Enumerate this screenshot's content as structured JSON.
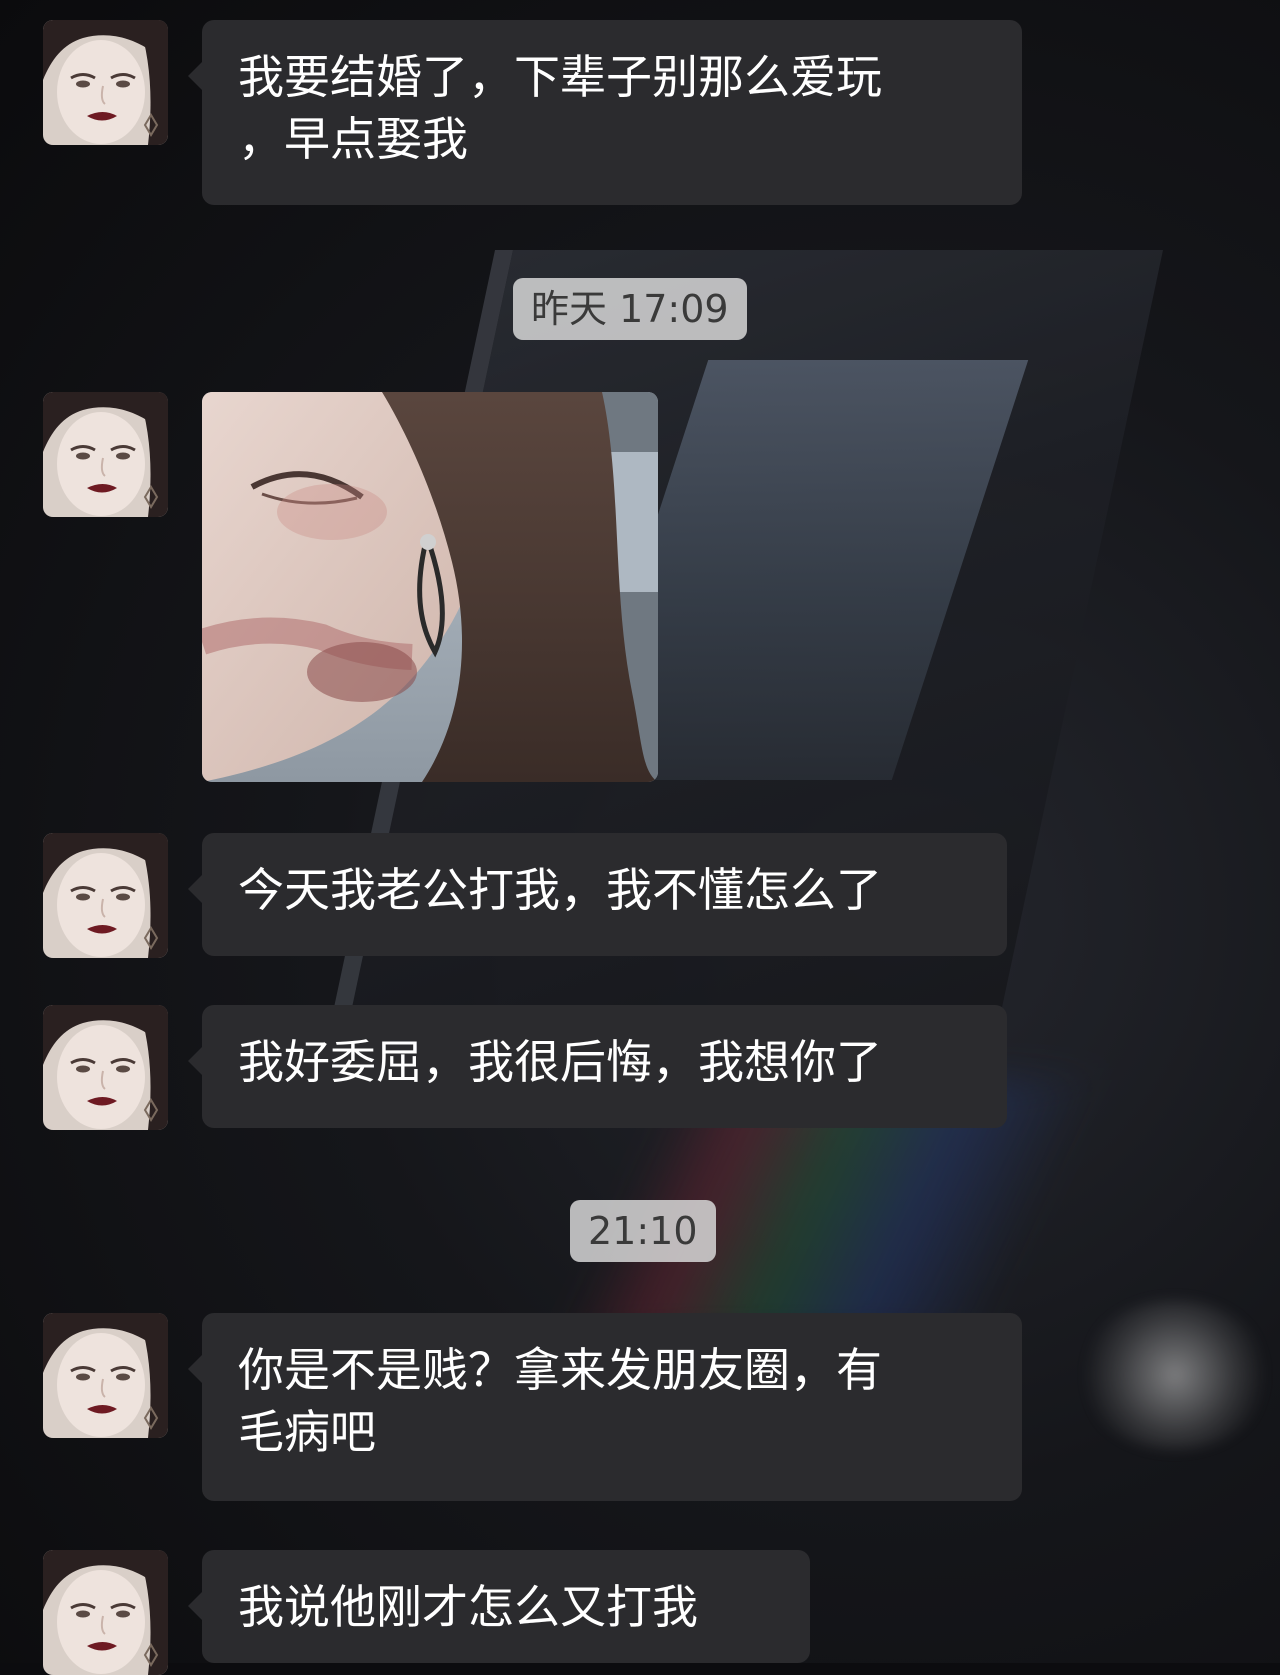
{
  "chat": {
    "timestamps": {
      "first": "昨天 17:09",
      "second": "21:10"
    },
    "messages": [
      {
        "lines": [
          "我要结婚了，下辈子别那么爱玩",
          "，早点娶我"
        ]
      },
      {
        "lines": [
          "今天我老公打我，我不懂怎么了"
        ]
      },
      {
        "lines": [
          "我好委屈，我很后悔，我想你了"
        ]
      },
      {
        "lines": [
          "你是不是贱？拿来发朋友圈，有",
          "毛病吧"
        ]
      },
      {
        "lines": [
          "我说他刚才怎么又打我"
        ]
      }
    ]
  },
  "colors": {
    "bubble": "#2b2b2e",
    "text": "#ffffff",
    "timestamp_bg": "#d7d7d7",
    "background": "#0c0c0f"
  }
}
